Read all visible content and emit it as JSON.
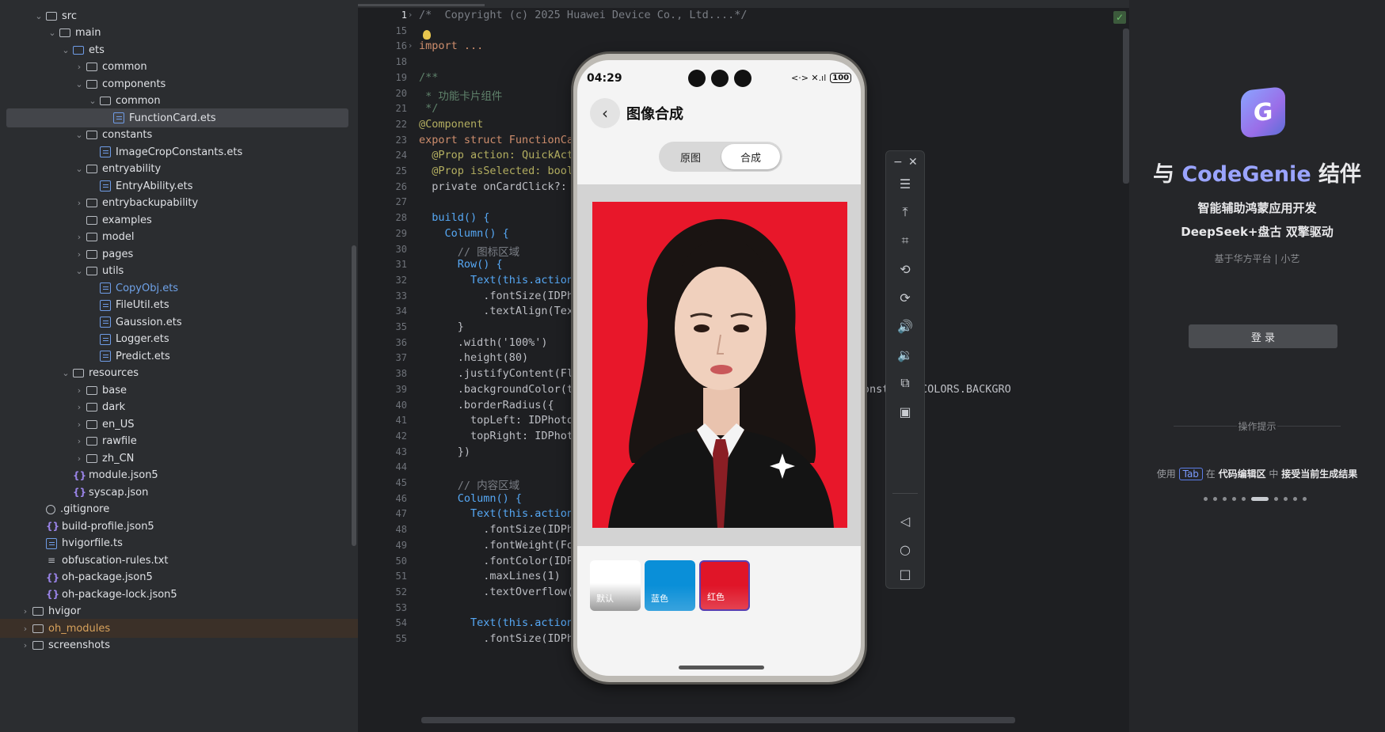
{
  "tree": {
    "items": [
      {
        "label": "src",
        "type": "folder",
        "depth": 2,
        "expanded": true
      },
      {
        "label": "main",
        "type": "folder",
        "depth": 3,
        "expanded": true
      },
      {
        "label": "ets",
        "type": "folder-blue",
        "depth": 4,
        "expanded": true
      },
      {
        "label": "common",
        "type": "folder",
        "depth": 5,
        "expanded": false
      },
      {
        "label": "components",
        "type": "folder",
        "depth": 5,
        "expanded": true
      },
      {
        "label": "common",
        "type": "folder",
        "depth": 6,
        "expanded": true
      },
      {
        "label": "FunctionCard.ets",
        "type": "file",
        "depth": 7,
        "selected": true
      },
      {
        "label": "constants",
        "type": "folder",
        "depth": 5,
        "expanded": true
      },
      {
        "label": "ImageCropConstants.ets",
        "type": "file",
        "depth": 6
      },
      {
        "label": "entryability",
        "type": "folder",
        "depth": 5,
        "expanded": true
      },
      {
        "label": "EntryAbility.ets",
        "type": "file",
        "depth": 6
      },
      {
        "label": "entrybackupability",
        "type": "folder",
        "depth": 5,
        "expanded": false
      },
      {
        "label": "examples",
        "type": "folder",
        "depth": 5,
        "nochev": true
      },
      {
        "label": "model",
        "type": "folder",
        "depth": 5,
        "expanded": false
      },
      {
        "label": "pages",
        "type": "folder",
        "depth": 5,
        "expanded": false
      },
      {
        "label": "utils",
        "type": "folder",
        "depth": 5,
        "expanded": true
      },
      {
        "label": "CopyObj.ets",
        "type": "file",
        "depth": 6,
        "color": "blue"
      },
      {
        "label": "FileUtil.ets",
        "type": "file",
        "depth": 6
      },
      {
        "label": "Gaussion.ets",
        "type": "file",
        "depth": 6
      },
      {
        "label": "Logger.ets",
        "type": "file",
        "depth": 6
      },
      {
        "label": "Predict.ets",
        "type": "file",
        "depth": 6
      },
      {
        "label": "resources",
        "type": "folder",
        "depth": 4,
        "expanded": true
      },
      {
        "label": "base",
        "type": "folder",
        "depth": 5,
        "expanded": false
      },
      {
        "label": "dark",
        "type": "folder",
        "depth": 5,
        "expanded": false
      },
      {
        "label": "en_US",
        "type": "folder",
        "depth": 5,
        "expanded": false
      },
      {
        "label": "rawfile",
        "type": "folder",
        "depth": 5,
        "expanded": false
      },
      {
        "label": "zh_CN",
        "type": "folder",
        "depth": 5,
        "expanded": false
      },
      {
        "label": "module.json5",
        "type": "json",
        "depth": 4
      },
      {
        "label": "syscap.json",
        "type": "json",
        "depth": 4
      },
      {
        "label": ".gitignore",
        "type": "git",
        "depth": 2
      },
      {
        "label": "build-profile.json5",
        "type": "json",
        "depth": 2
      },
      {
        "label": "hvigorfile.ts",
        "type": "file",
        "depth": 2
      },
      {
        "label": "obfuscation-rules.txt",
        "type": "txt",
        "depth": 2
      },
      {
        "label": "oh-package.json5",
        "type": "json",
        "depth": 2
      },
      {
        "label": "oh-package-lock.json5",
        "type": "json",
        "depth": 2
      },
      {
        "label": "hvigor",
        "type": "folder",
        "depth": 1,
        "expanded": false
      },
      {
        "label": "oh_modules",
        "type": "folder",
        "depth": 1,
        "expanded": false,
        "highlight": true,
        "color": "orange"
      },
      {
        "label": "screenshots",
        "type": "folder",
        "depth": 1,
        "expanded": false
      }
    ]
  },
  "editor": {
    "lines": [
      {
        "n": "1",
        "text": "/*  Copyright (c) 2025 Huawei Device Co., Ltd....*/",
        "color": "#7a7e85",
        "fold": true
      },
      {
        "n": "15",
        "text": ""
      },
      {
        "n": "16",
        "text": "import ...",
        "color": "#cf8e6d",
        "fold": true
      },
      {
        "n": "18",
        "text": ""
      },
      {
        "n": "19",
        "text": "/**",
        "color": "#5f826b"
      },
      {
        "n": "20",
        "text": " * 功能卡片组件",
        "color": "#5f826b"
      },
      {
        "n": "21",
        "text": " */",
        "color": "#5f826b"
      },
      {
        "n": "22",
        "text": "@Component",
        "color": "#b3ae60"
      },
      {
        "n": "23",
        "text": "export struct FunctionCa",
        "color": "#cf8e6d"
      },
      {
        "n": "24",
        "text": "  @Prop action: QuickAct",
        "color": "#b3ae60"
      },
      {
        "n": "25",
        "text": "  @Prop isSelected: boole",
        "color": "#b3ae60"
      },
      {
        "n": "26",
        "text": "  private onCardClick?: ",
        "color": "#bcbec4"
      },
      {
        "n": "27",
        "text": ""
      },
      {
        "n": "28",
        "text": "  build() {",
        "color": "#56a8f5"
      },
      {
        "n": "29",
        "text": "    Column() {",
        "color": "#56a8f5"
      },
      {
        "n": "30",
        "text": "      // 图标区域",
        "color": "#7a7e85"
      },
      {
        "n": "31",
        "text": "      Row() {",
        "color": "#56a8f5"
      },
      {
        "n": "32",
        "text": "        Text(this.action",
        "color": "#56a8f5"
      },
      {
        "n": "33",
        "text": "          .fontSize(IDPho",
        "color": "#bcbec4"
      },
      {
        "n": "34",
        "text": "          .textAlign(Tex",
        "color": "#bcbec4"
      },
      {
        "n": "35",
        "text": "      }",
        "color": "#bcbec4"
      },
      {
        "n": "36",
        "text": "      .width('100%')",
        "color": "#bcbec4"
      },
      {
        "n": "37",
        "text": "      .height(80)",
        "color": "#bcbec4"
      },
      {
        "n": "38",
        "text": "      .justifyContent(Fl",
        "color": "#bcbec4"
      },
      {
        "n": "39",
        "text": "      .backgroundColor(th                          RY_L      IDPhotoConstants.COLORS.BACKGRO",
        "color": "#bcbec4"
      },
      {
        "n": "40",
        "text": "      .borderRadius({",
        "color": "#bcbec4"
      },
      {
        "n": "41",
        "text": "        topLeft: IDPhoto",
        "color": "#bcbec4"
      },
      {
        "n": "42",
        "text": "        topRight: IDPhot",
        "color": "#bcbec4"
      },
      {
        "n": "43",
        "text": "      })",
        "color": "#bcbec4"
      },
      {
        "n": "44",
        "text": ""
      },
      {
        "n": "45",
        "text": "      // 内容区域",
        "color": "#7a7e85"
      },
      {
        "n": "46",
        "text": "      Column() {",
        "color": "#56a8f5"
      },
      {
        "n": "47",
        "text": "        Text(this.action",
        "color": "#56a8f5"
      },
      {
        "n": "48",
        "text": "          .fontSize(IDPh",
        "color": "#bcbec4"
      },
      {
        "n": "49",
        "text": "          .fontWeight(For",
        "color": "#bcbec4"
      },
      {
        "n": "50",
        "text": "          .fontColor(IDPh",
        "color": "#bcbec4"
      },
      {
        "n": "51",
        "text": "          .maxLines(1)",
        "color": "#bcbec4"
      },
      {
        "n": "52",
        "text": "          .textOverflow({",
        "color": "#bcbec4"
      },
      {
        "n": "53",
        "text": ""
      },
      {
        "n": "54",
        "text": "        Text(this.action.description)",
        "color": "#56a8f5"
      },
      {
        "n": "55",
        "text": "          .fontSize(IDPhotoConstants.UI_SIZES.FONT_SIZE_SMALL)",
        "color": "#bcbec4"
      }
    ]
  },
  "phone": {
    "time": "04:29",
    "status_icons": "<·> ✕.ıl",
    "battery": "100",
    "title": "图像合成",
    "seg_original": "原图",
    "seg_composite": "合成",
    "swatches": [
      {
        "label": "默认",
        "color": "#ffffff"
      },
      {
        "label": "蓝色",
        "color": "#0a8fd8"
      },
      {
        "label": "红色",
        "color": "#e01528"
      }
    ],
    "background_color": "#e8172a"
  },
  "emulator": {
    "minimize": "−",
    "close": "✕",
    "buttons": [
      "menu-icon",
      "to-top-icon",
      "crop-icon",
      "rotate-left-icon",
      "rotate-right-icon",
      "volume-up-icon",
      "volume-down-icon",
      "shake-icon",
      "screenshot-icon",
      "back-nav-icon",
      "home-nav-icon",
      "recents-nav-icon"
    ]
  },
  "genie": {
    "logo": "G",
    "title_prefix": "与 ",
    "title_brand": "CodeGenie",
    "title_suffix": " 结伴",
    "subtitle1": "智能辅助鸿蒙应用开发",
    "subtitle2": "DeepSeek+盘古 双擎驱动",
    "subtitle3": "基于华方平台 | 小艺",
    "login": "登 录",
    "tip_header": "操作提示",
    "tip_use": "使用 ",
    "tip_key": "Tab",
    "tip_in": " 在 ",
    "tip_area": "代码编辑区",
    "tip_mid": " 中 ",
    "tip_action": "接受当前生成结果"
  }
}
